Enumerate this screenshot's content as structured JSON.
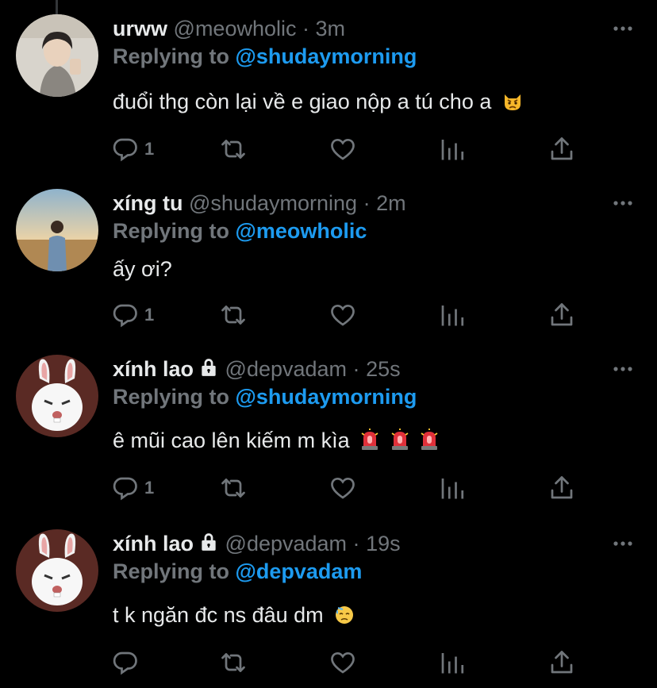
{
  "tweets": [
    {
      "name": "urww",
      "handle": "@meowholic",
      "separator": "·",
      "time": "3m",
      "locked": false,
      "replying_prefix": "Replying to",
      "replying_to": "@shudaymorning",
      "text": "đuổi thg còn lại về e giao nộp a tú cho a",
      "emoji": [
        "pouting-cat-icon"
      ],
      "reply_count": "1"
    },
    {
      "name": "xíng tu",
      "handle": "@shudaymorning",
      "separator": "·",
      "time": "2m",
      "locked": false,
      "replying_prefix": "Replying to",
      "replying_to": "@meowholic",
      "text": "ấy ơi?",
      "emoji": [],
      "reply_count": "1"
    },
    {
      "name": "xính lao",
      "handle": "@depvadam",
      "separator": "·",
      "time": "25s",
      "locked": true,
      "replying_prefix": "Replying to",
      "replying_to": "@shudaymorning",
      "text": "ê mũi cao lên kiếm m kìa",
      "emoji": [
        "siren-icon",
        "siren-icon",
        "siren-icon"
      ],
      "reply_count": "1"
    },
    {
      "name": "xính lao",
      "handle": "@depvadam",
      "separator": "·",
      "time": "19s",
      "locked": true,
      "replying_prefix": "Replying to",
      "replying_to": "@depvadam",
      "text": "t k ngăn đc ns đâu dm",
      "emoji": [
        "downcast-sweat-face-icon"
      ],
      "reply_count": ""
    }
  ],
  "colors": {
    "background": "#000000",
    "text": "#e7e9ea",
    "secondary": "#71767b",
    "link": "#1d9bf0",
    "thread_line": "#333639"
  }
}
